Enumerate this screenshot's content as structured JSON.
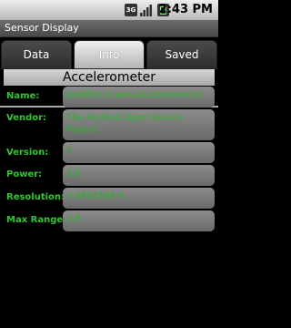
{
  "status_bar": {
    "network_label": "3G",
    "time": "2:43 PM",
    "accent_color": "#2ec82e"
  },
  "app": {
    "title": "Sensor Display"
  },
  "tabs": [
    {
      "label": "Data",
      "selected": false
    },
    {
      "label": "Info",
      "selected": true
    },
    {
      "label": "Saved",
      "selected": false
    }
  ],
  "sensor": {
    "name": "Accelerometer",
    "rows": [
      {
        "label": "Name:",
        "value": "Goldfish 3-axis Accelerometer"
      },
      {
        "label": "Vendor:",
        "value": "The Android Open Source Project"
      },
      {
        "label": "Version:",
        "value": "1"
      },
      {
        "label": "Power:",
        "value": "3.0"
      },
      {
        "label": "Resolution:",
        "value": "2.480159E-4"
      },
      {
        "label": "Max Range:",
        "value": "2.8"
      }
    ]
  },
  "icons": [
    "signal-icon",
    "battery-icon"
  ]
}
